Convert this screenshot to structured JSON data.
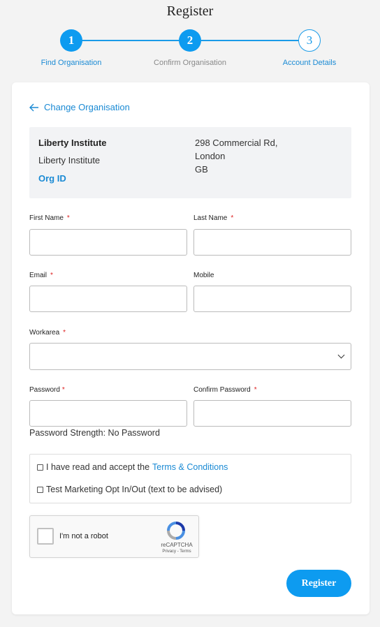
{
  "page": {
    "title": "Register"
  },
  "steps": [
    {
      "number": "1",
      "label": "Find Organisation"
    },
    {
      "number": "2",
      "label": "Confirm Organisation"
    },
    {
      "number": "3",
      "label": "Account Details"
    }
  ],
  "change_org": {
    "label": "Change Organisation",
    "icon": "arrow-left-icon"
  },
  "org": {
    "name": "Liberty Institute",
    "subname": "Liberty Institute",
    "id_label": "Org ID",
    "address": [
      "298 Commercial Rd,",
      "London",
      "GB"
    ]
  },
  "form": {
    "first_name": "First Name",
    "last_name": "Last Name",
    "email": "Email",
    "mobile": "Mobile",
    "workarea": "Workarea",
    "password": "Password",
    "confirm_password": "Confirm Password",
    "required_mark": "*",
    "password_strength": "Password Strength: No Password"
  },
  "consents": {
    "terms_prefix": "I have read and accept the",
    "terms_link": "Terms & Conditions",
    "marketing": "Test Marketing Opt In/Out (text to be advised)"
  },
  "captcha": {
    "label": "I'm not a robot",
    "brand": "reCAPTCHA",
    "links": "Privacy - Terms"
  },
  "submit": {
    "label": "Register"
  },
  "colors": {
    "accent": "#0d9bf0",
    "link": "#1a8ad4",
    "required": "#dd2222"
  }
}
